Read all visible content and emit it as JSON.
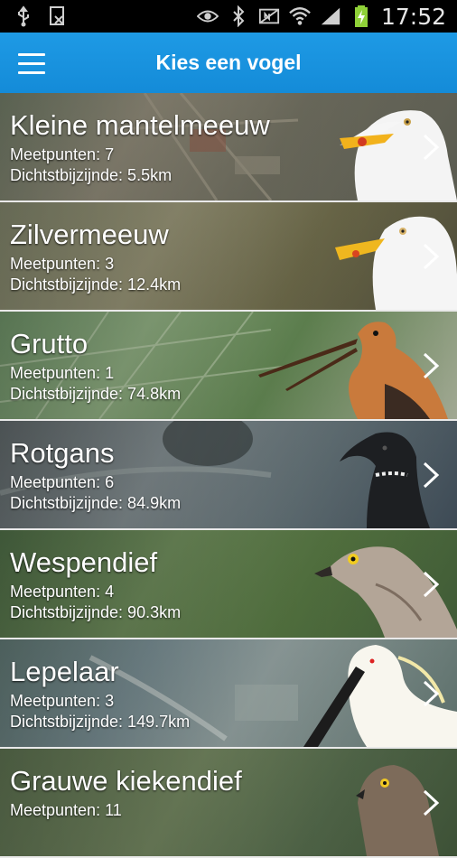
{
  "statusbar": {
    "time": "17:52",
    "icons": [
      "usb-icon",
      "screenshot-icon",
      "eye-icon",
      "bluetooth-icon",
      "nfc-icon",
      "wifi-icon",
      "signal-icon",
      "battery-charging-icon"
    ]
  },
  "appbar": {
    "title": "Kies een vogel",
    "menu_icon": "hamburger-menu-icon"
  },
  "colors": {
    "appbar": "#1a94df",
    "divider": "#e9e9e9"
  },
  "birds": [
    {
      "name": "Kleine mantelmeeuw",
      "meetpunten": "Meetpunten: 7",
      "dichtstbij": "Dichtstbijzijnde: 5.5km"
    },
    {
      "name": "Zilvermeeuw",
      "meetpunten": "Meetpunten: 3",
      "dichtstbij": "Dichtstbijzijnde: 12.4km"
    },
    {
      "name": "Grutto",
      "meetpunten": "Meetpunten: 1",
      "dichtstbij": "Dichtstbijzijnde: 74.8km"
    },
    {
      "name": "Rotgans",
      "meetpunten": "Meetpunten: 6",
      "dichtstbij": "Dichtstbijzijnde: 84.9km"
    },
    {
      "name": "Wespendief",
      "meetpunten": "Meetpunten: 4",
      "dichtstbij": "Dichtstbijzijnde: 90.3km"
    },
    {
      "name": "Lepelaar",
      "meetpunten": "Meetpunten: 3",
      "dichtstbij": "Dichtstbijzijnde: 149.7km"
    },
    {
      "name": "Grauwe kiekendief",
      "meetpunten": "Meetpunten: 11",
      "dichtstbij": ""
    }
  ]
}
